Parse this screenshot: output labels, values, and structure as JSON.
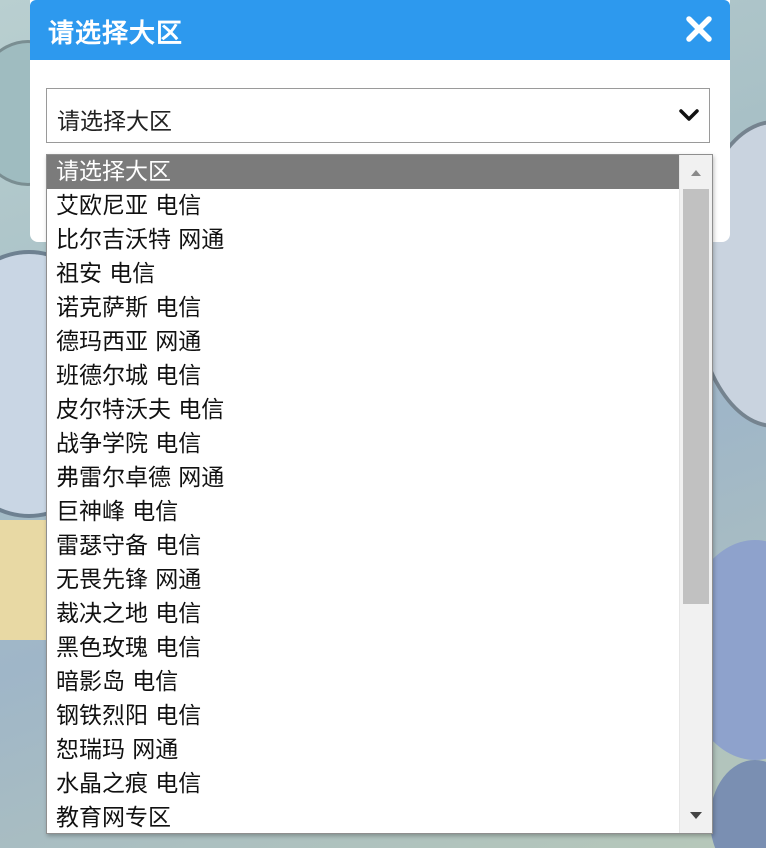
{
  "dialog": {
    "title": "请选择大区",
    "close_icon": "close-icon",
    "header_color": "#2d99ee"
  },
  "select": {
    "value": "请选择大区",
    "chevron_icon": "chevron-down-icon"
  },
  "dropdown": {
    "selected_index": 0,
    "options": [
      "请选择大区",
      "艾欧尼亚 电信",
      "比尔吉沃特 网通",
      "祖安 电信",
      "诺克萨斯 电信",
      "德玛西亚 网通",
      "班德尔城 电信",
      "皮尔特沃夫 电信",
      "战争学院 电信",
      "弗雷尔卓德 网通",
      "巨神峰 电信",
      "雷瑟守备 电信",
      "无畏先锋 网通",
      "裁决之地 电信",
      "黑色玫瑰 电信",
      "暗影岛 电信",
      "钢铁烈阳 电信",
      "恕瑞玛 网通",
      "水晶之痕 电信",
      "教育网专区"
    ],
    "scrollbar": {
      "up_icon": "scroll-up-arrow-icon",
      "down_icon": "scroll-down-arrow-icon",
      "thumb_fraction": 0.68,
      "position_fraction": 0
    }
  }
}
